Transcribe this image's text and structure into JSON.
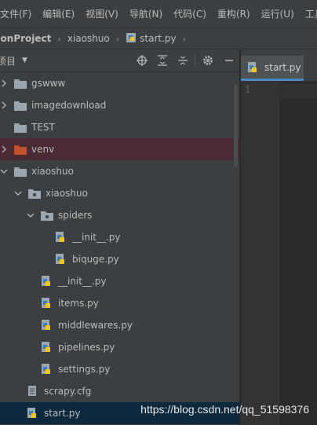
{
  "menubar": {
    "items": [
      "文件(F)",
      "编辑(E)",
      "视图(V)",
      "导航(N)",
      "代码(C)",
      "重构(R)",
      "运行(U)",
      "工具(T)"
    ]
  },
  "navbar": {
    "crumbs": [
      "honProject",
      "xiaoshuo",
      "start.py"
    ]
  },
  "project_panel": {
    "title": "项目",
    "tree": [
      {
        "label": "gswww",
        "type": "folder",
        "depth": 0,
        "expanded": false
      },
      {
        "label": "imagedownload",
        "type": "folder",
        "depth": 0,
        "expanded": false
      },
      {
        "label": "TEST",
        "type": "folder",
        "depth": 0,
        "expanded": null
      },
      {
        "label": "venv",
        "type": "folder-excluded",
        "depth": 0,
        "expanded": false
      },
      {
        "label": "xiaoshuo",
        "type": "folder",
        "depth": 0,
        "expanded": true
      },
      {
        "label": "xiaoshuo",
        "type": "package",
        "depth": 1,
        "expanded": true
      },
      {
        "label": "spiders",
        "type": "package",
        "depth": 2,
        "expanded": true
      },
      {
        "label": "__init__.py",
        "type": "python",
        "depth": 3
      },
      {
        "label": "biquge.py",
        "type": "python",
        "depth": 3
      },
      {
        "label": "__init__.py",
        "type": "python",
        "depth": 2
      },
      {
        "label": "items.py",
        "type": "python",
        "depth": 2
      },
      {
        "label": "middlewares.py",
        "type": "python",
        "depth": 2
      },
      {
        "label": "pipelines.py",
        "type": "python",
        "depth": 2
      },
      {
        "label": "settings.py",
        "type": "python",
        "depth": 2
      },
      {
        "label": "scrapy.cfg",
        "type": "config",
        "depth": 1
      },
      {
        "label": "start.py",
        "type": "python",
        "depth": 1
      }
    ]
  },
  "editor": {
    "tab_label": "start.py",
    "line_number": "1"
  },
  "watermark": "https://blog.csdn.net/qq_51598376",
  "colors": {
    "background": "#2b2b2b",
    "panel": "#3c3f41",
    "excluded_folder": "#c0522b",
    "folder": "#9aa7b0",
    "selection": "#0d293e"
  }
}
